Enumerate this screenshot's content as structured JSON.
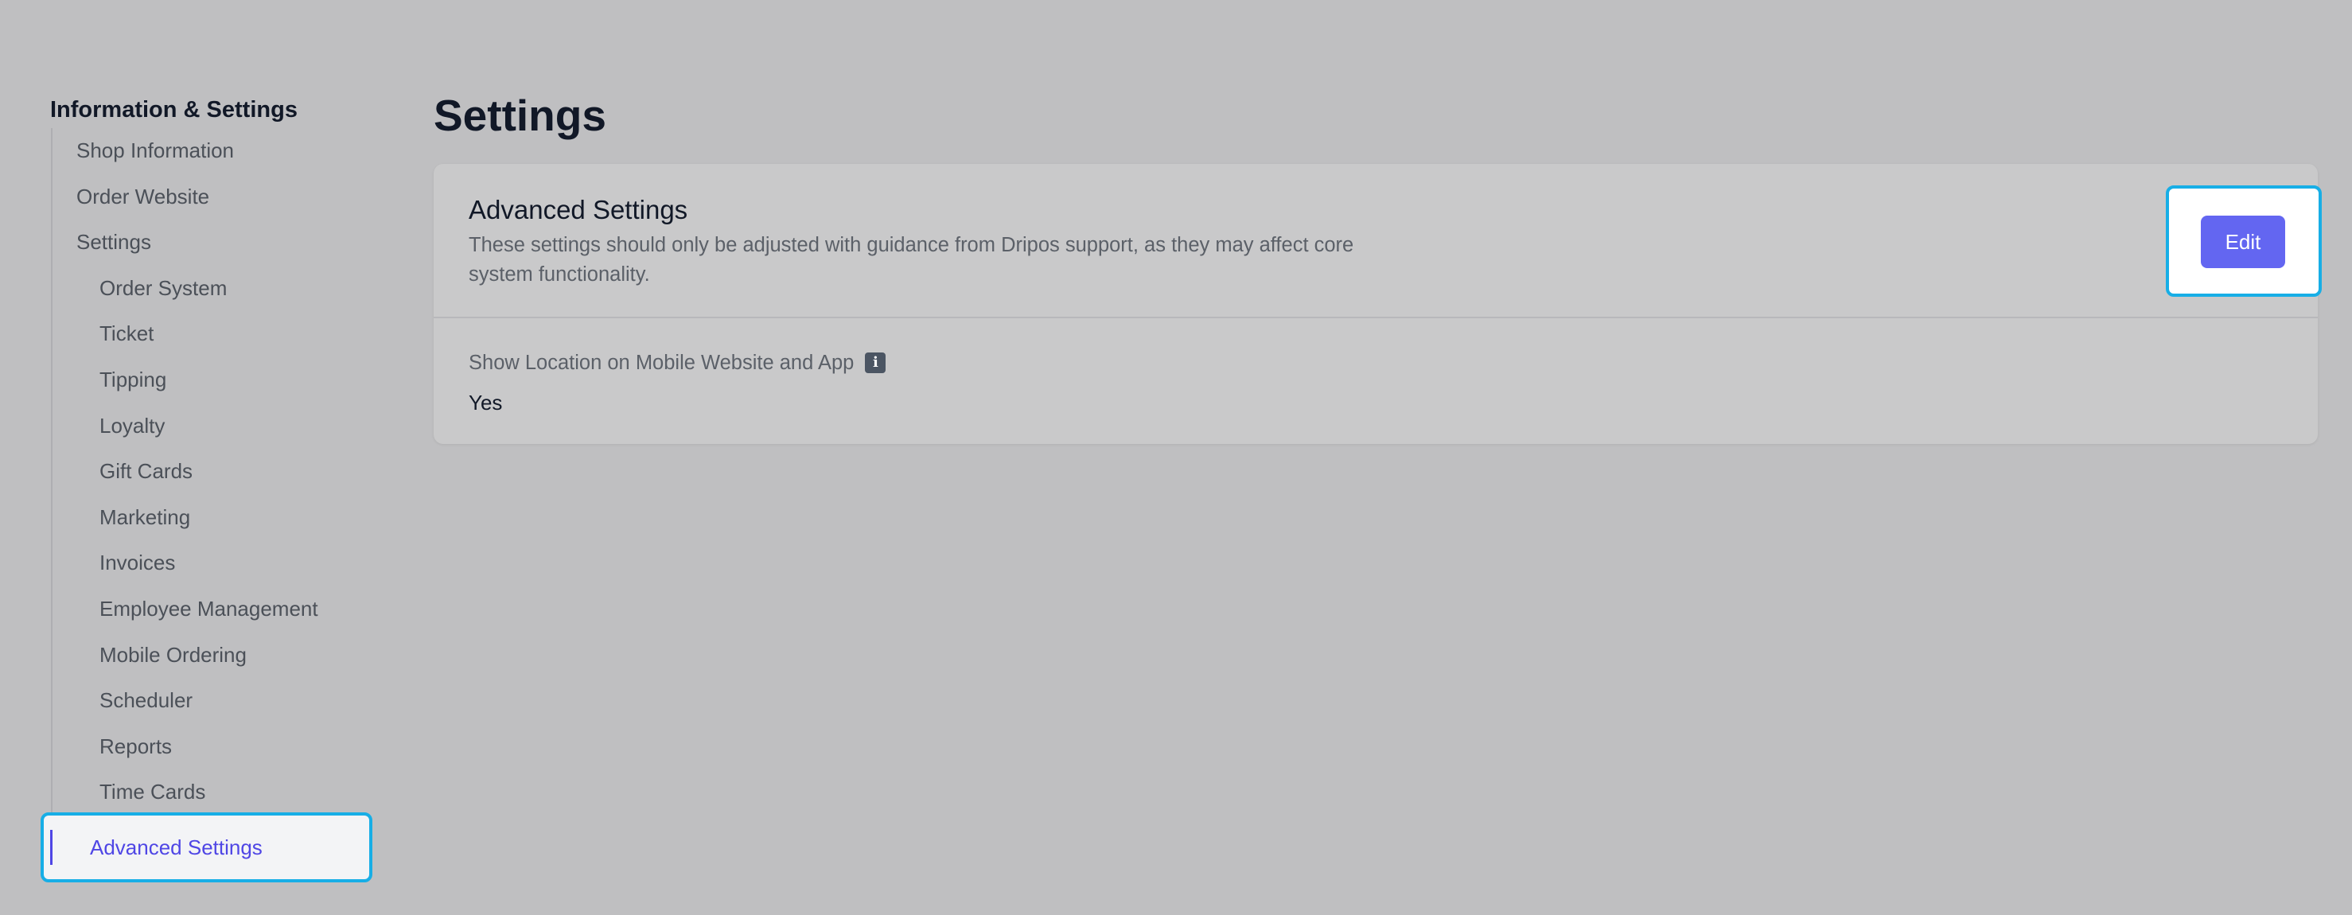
{
  "sidebar": {
    "heading": "Information & Settings",
    "items": [
      {
        "label": "Shop Information",
        "level": 1
      },
      {
        "label": "Order Website",
        "level": 1
      },
      {
        "label": "Settings",
        "level": 1
      },
      {
        "label": "Order System",
        "level": 2
      },
      {
        "label": "Ticket",
        "level": 2
      },
      {
        "label": "Tipping",
        "level": 2
      },
      {
        "label": "Loyalty",
        "level": 2
      },
      {
        "label": "Gift Cards",
        "level": 2
      },
      {
        "label": "Marketing",
        "level": 2
      },
      {
        "label": "Invoices",
        "level": 2
      },
      {
        "label": "Employee Management",
        "level": 2
      },
      {
        "label": "Mobile Ordering",
        "level": 2
      },
      {
        "label": "Scheduler",
        "level": 2
      },
      {
        "label": "Reports",
        "level": 2
      },
      {
        "label": "Time Cards",
        "level": 2
      }
    ],
    "active_item": {
      "label": "Advanced Settings",
      "level": 2
    }
  },
  "main": {
    "title": "Settings",
    "card": {
      "title": "Advanced Settings",
      "description": "These settings should only be adjusted with guidance from Dripos support, as they may affect core system functionality.",
      "edit_label": "Edit",
      "fields": [
        {
          "label": "Show Location on Mobile Website and App",
          "info_icon": "info-icon",
          "value": "Yes"
        }
      ]
    }
  },
  "colors": {
    "page_background": "#bfbfc1",
    "card_background": "#c9c9ca",
    "accent": "#4f46e5",
    "button": "#6366f1",
    "highlight_border": "#17aee6"
  }
}
